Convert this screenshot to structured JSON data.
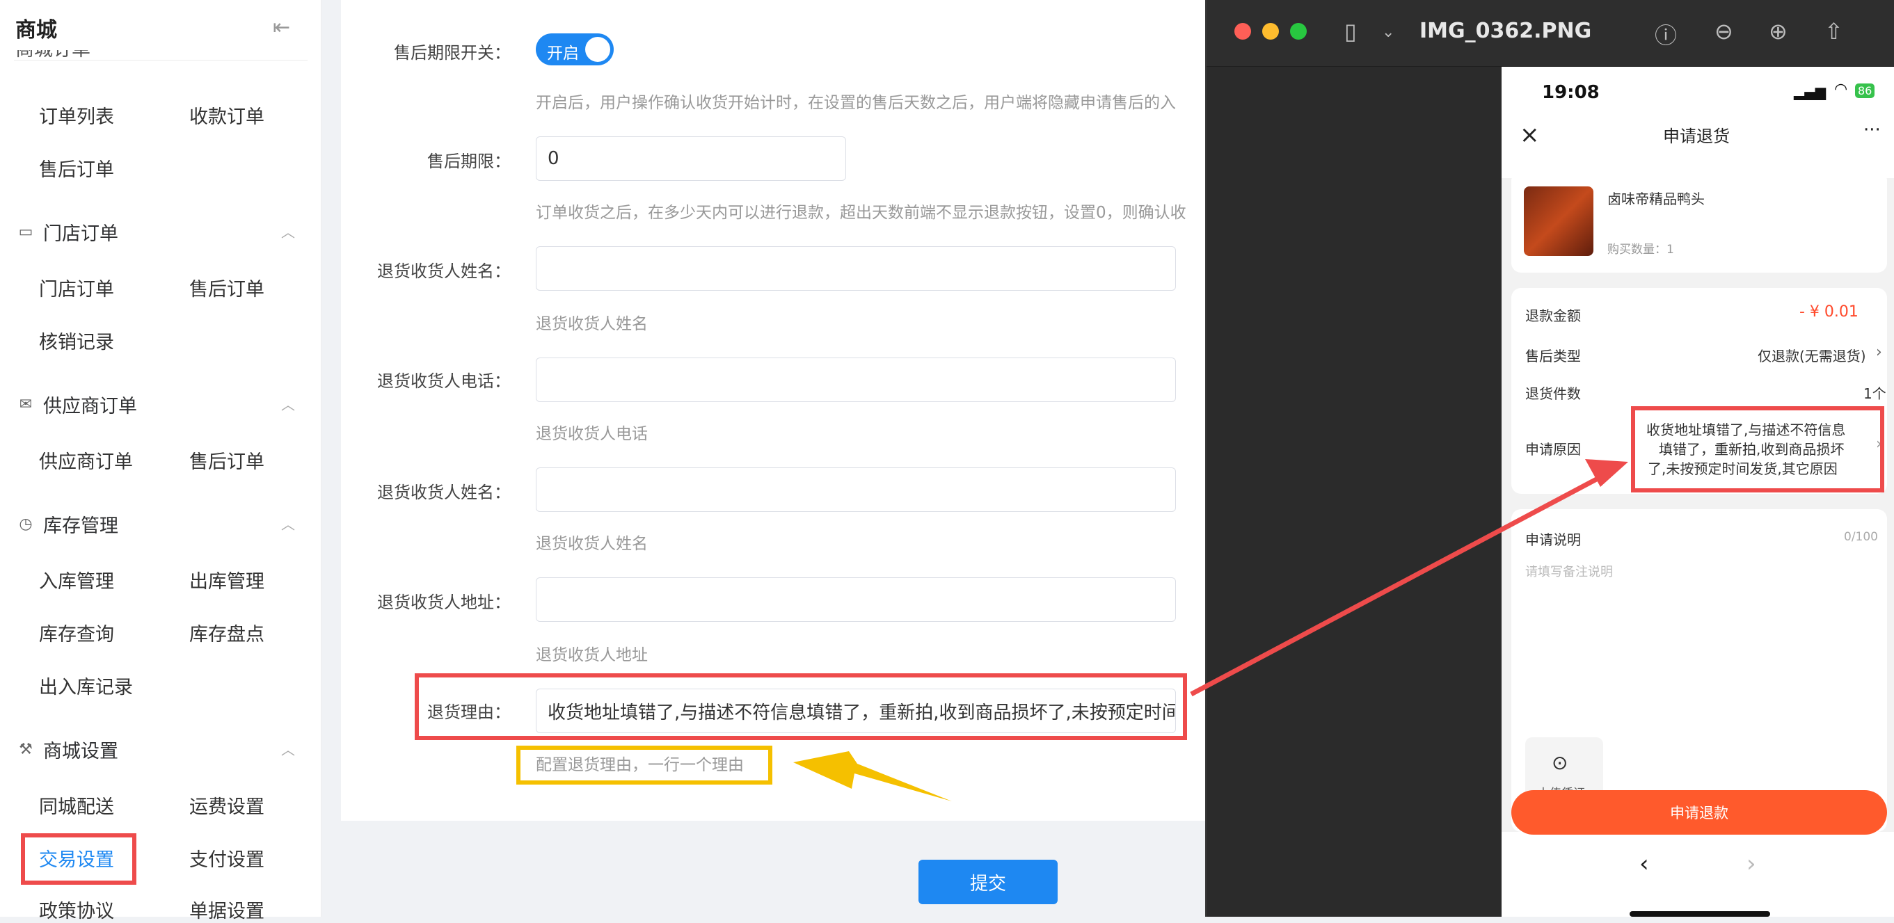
{
  "sidebar": {
    "brand": "商城",
    "partial_top": "商城订单",
    "groups": [
      {
        "label": "门店订单",
        "icon": "calendar-icon"
      },
      {
        "label": "供应商订单",
        "icon": "inbox-icon"
      },
      {
        "label": "库存管理",
        "icon": "chart-icon"
      },
      {
        "label": "商城设置",
        "icon": "wrench-icon"
      }
    ],
    "items": [
      "订单列表",
      "收款订单",
      "售后订单",
      "门店订单",
      "售后订单",
      "核销记录",
      "供应商订单",
      "售后订单",
      "入库管理",
      "出库管理",
      "库存查询",
      "库存盘点",
      "出入库记录",
      "同城配送",
      "运费设置",
      "交易设置",
      "支付设置",
      "政策协议",
      "单据设置"
    ]
  },
  "form": {
    "aftersale_switch_label": "售后期限开关：",
    "toggle_text": "开启",
    "aftersale_switch_hint": "开启后，用户操作确认收货开始计时，在设置的售后天数之后，用户端将隐藏申请售后的入",
    "period_label": "售后期限：",
    "period_value": "0",
    "period_hint": "订单收货之后，在多少天内可以进行退款，超出天数前端不显示退款按钮，设置0，则确认收",
    "name_label": "退货收货人姓名：",
    "name_hint": "退货收货人姓名",
    "phone_label": "退货收货人电话：",
    "phone_hint": "退货收货人电话",
    "name2_label": "退货收货人姓名：",
    "name2_hint": "退货收货人姓名",
    "address_label": "退货收货人地址：",
    "address_hint": "退货收货人地址",
    "reason_label": "退货理由：",
    "reason_value": "收货地址填错了,与描述不符信息填错了，重新拍,收到商品损坏了,未按预定时间发货,",
    "reason_hint": "配置退货理由，一行一个理由",
    "submit": "提交"
  },
  "viewer": {
    "title": "IMG_0362.PNG",
    "phone": {
      "time": "19:08",
      "battery": "86",
      "page_title": "申请退货",
      "product_name": "卤味帝精品鸭头",
      "product_qty": "购买数量：1",
      "refund_amount_label": "退款金额",
      "refund_amount": "- ¥ 0.01",
      "type_label": "售后类型",
      "type_value": "仅退款(无需退货)",
      "count_label": "退货件数",
      "count_value": "1个",
      "reason_label": "申请原因",
      "reason_lines": [
        "收货地址填错了,与描述不符信息",
        "填错了，重新拍,收到商品损坏",
        "了,未按预定时间发货,其它原因"
      ],
      "desc_label": "申请说明",
      "desc_count": "0/100",
      "desc_placeholder": "请填写备注说明",
      "upload_label": "上传凭证",
      "apply_button": "申请退款"
    }
  },
  "colors": {
    "primary": "#1e88f2",
    "highlight_red": "#ee4b4b",
    "highlight_yellow": "#f5c000",
    "refund_orange": "#ff5a2c"
  }
}
